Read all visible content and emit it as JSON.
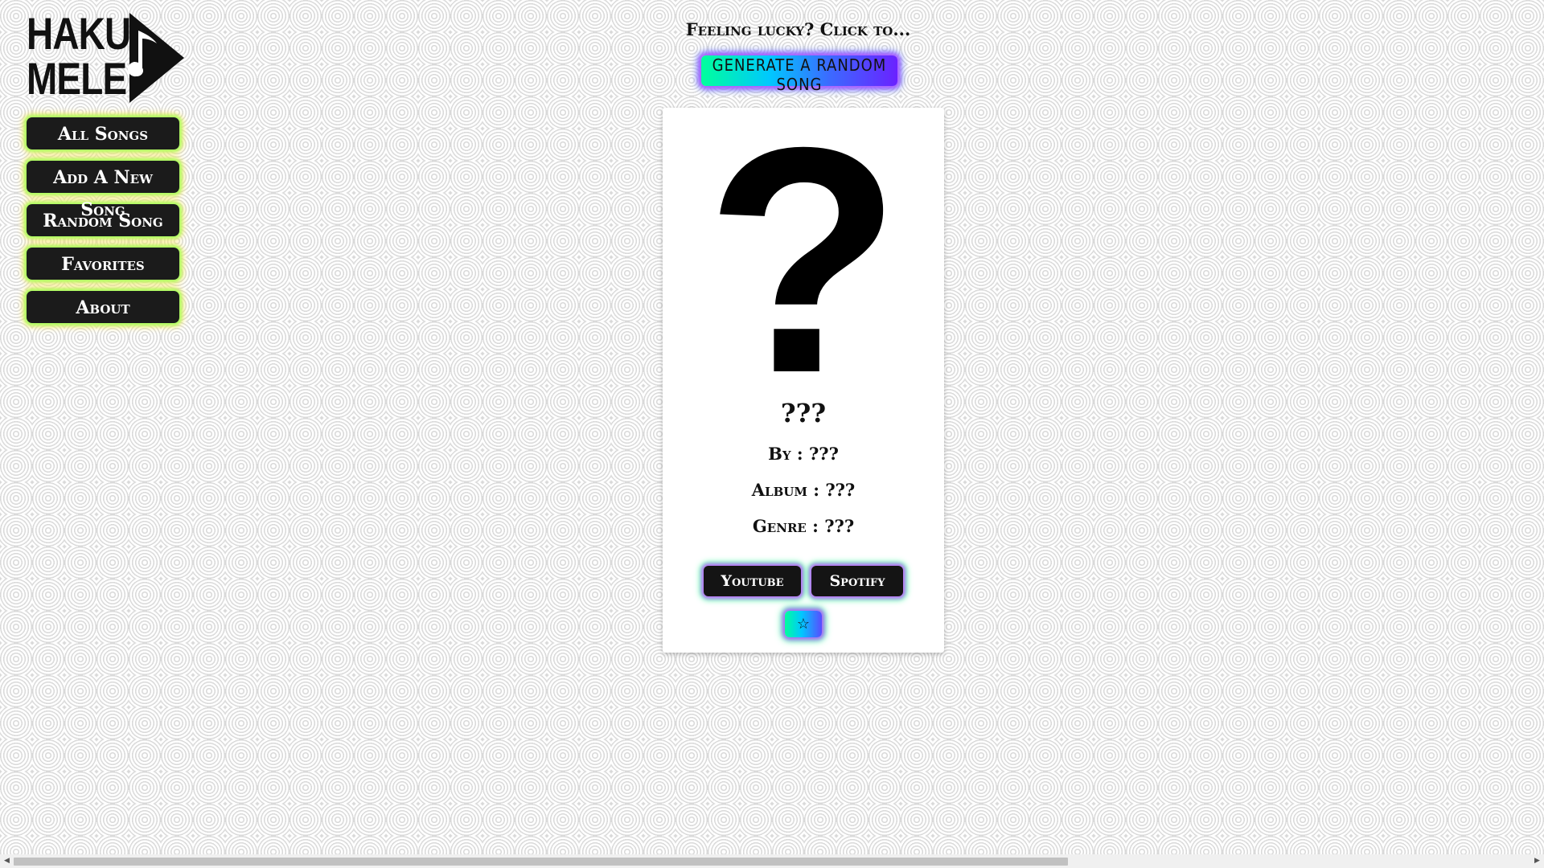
{
  "logo": {
    "line1": "HAKU",
    "line2": "MELE",
    "icon": "music-note-icon"
  },
  "nav": {
    "items": [
      {
        "label": "All Songs"
      },
      {
        "label": "Add A New Song"
      },
      {
        "label": "Random Song"
      },
      {
        "label": "Favorites"
      },
      {
        "label": "About"
      }
    ]
  },
  "header": {
    "prompt": "Feeling lucky? Click to...",
    "generate_label": "generate a random song"
  },
  "card": {
    "image_placeholder": "?",
    "title": "???",
    "by": "By : ???",
    "album": "Album : ???",
    "genre": "Genre : ???",
    "youtube_label": "Youtube",
    "spotify_label": "Spotify",
    "favorite_label": "☆"
  },
  "colors": {
    "accent_gradient_start": "#00ff9c",
    "accent_gradient_mid": "#00c8ff",
    "accent_gradient_end": "#6a22ff",
    "nav_glow": "#a8ff60",
    "button_bg": "#1b1b1b"
  }
}
